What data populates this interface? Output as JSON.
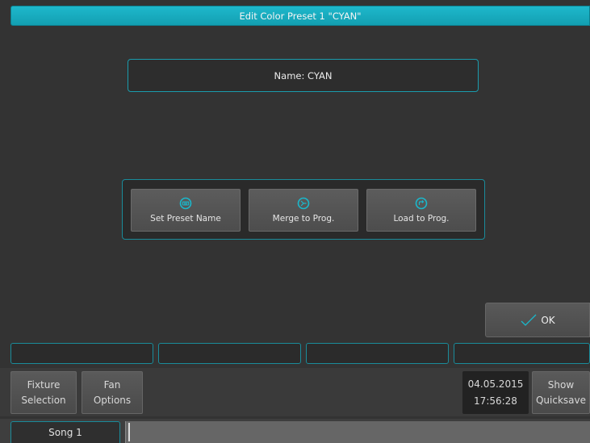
{
  "window": {
    "title": "Edit Color Preset 1 \"CYAN\""
  },
  "name_field": {
    "text": "Name: CYAN"
  },
  "actions": [
    {
      "label": "Set Preset Name",
      "icon": "keyboard-icon"
    },
    {
      "label": "Merge to Prog.",
      "icon": "merge-icon"
    },
    {
      "label": "Load to Prog.",
      "icon": "load-icon"
    }
  ],
  "ok_button": {
    "label": "OK",
    "icon": "checkmark-icon"
  },
  "bottom": {
    "fixture_selection": {
      "line1": "Fixture",
      "line2": "Selection"
    },
    "fan_options": {
      "line1": "Fan",
      "line2": "Options"
    },
    "date": "04.05.2015",
    "time": "17:56:28",
    "show_quicksave": {
      "line1": "Show",
      "line2": "Quicksave"
    }
  },
  "status": {
    "song": "Song 1"
  },
  "colors": {
    "accent": "#1aa9bb",
    "background": "#333333",
    "button": "#555555"
  }
}
